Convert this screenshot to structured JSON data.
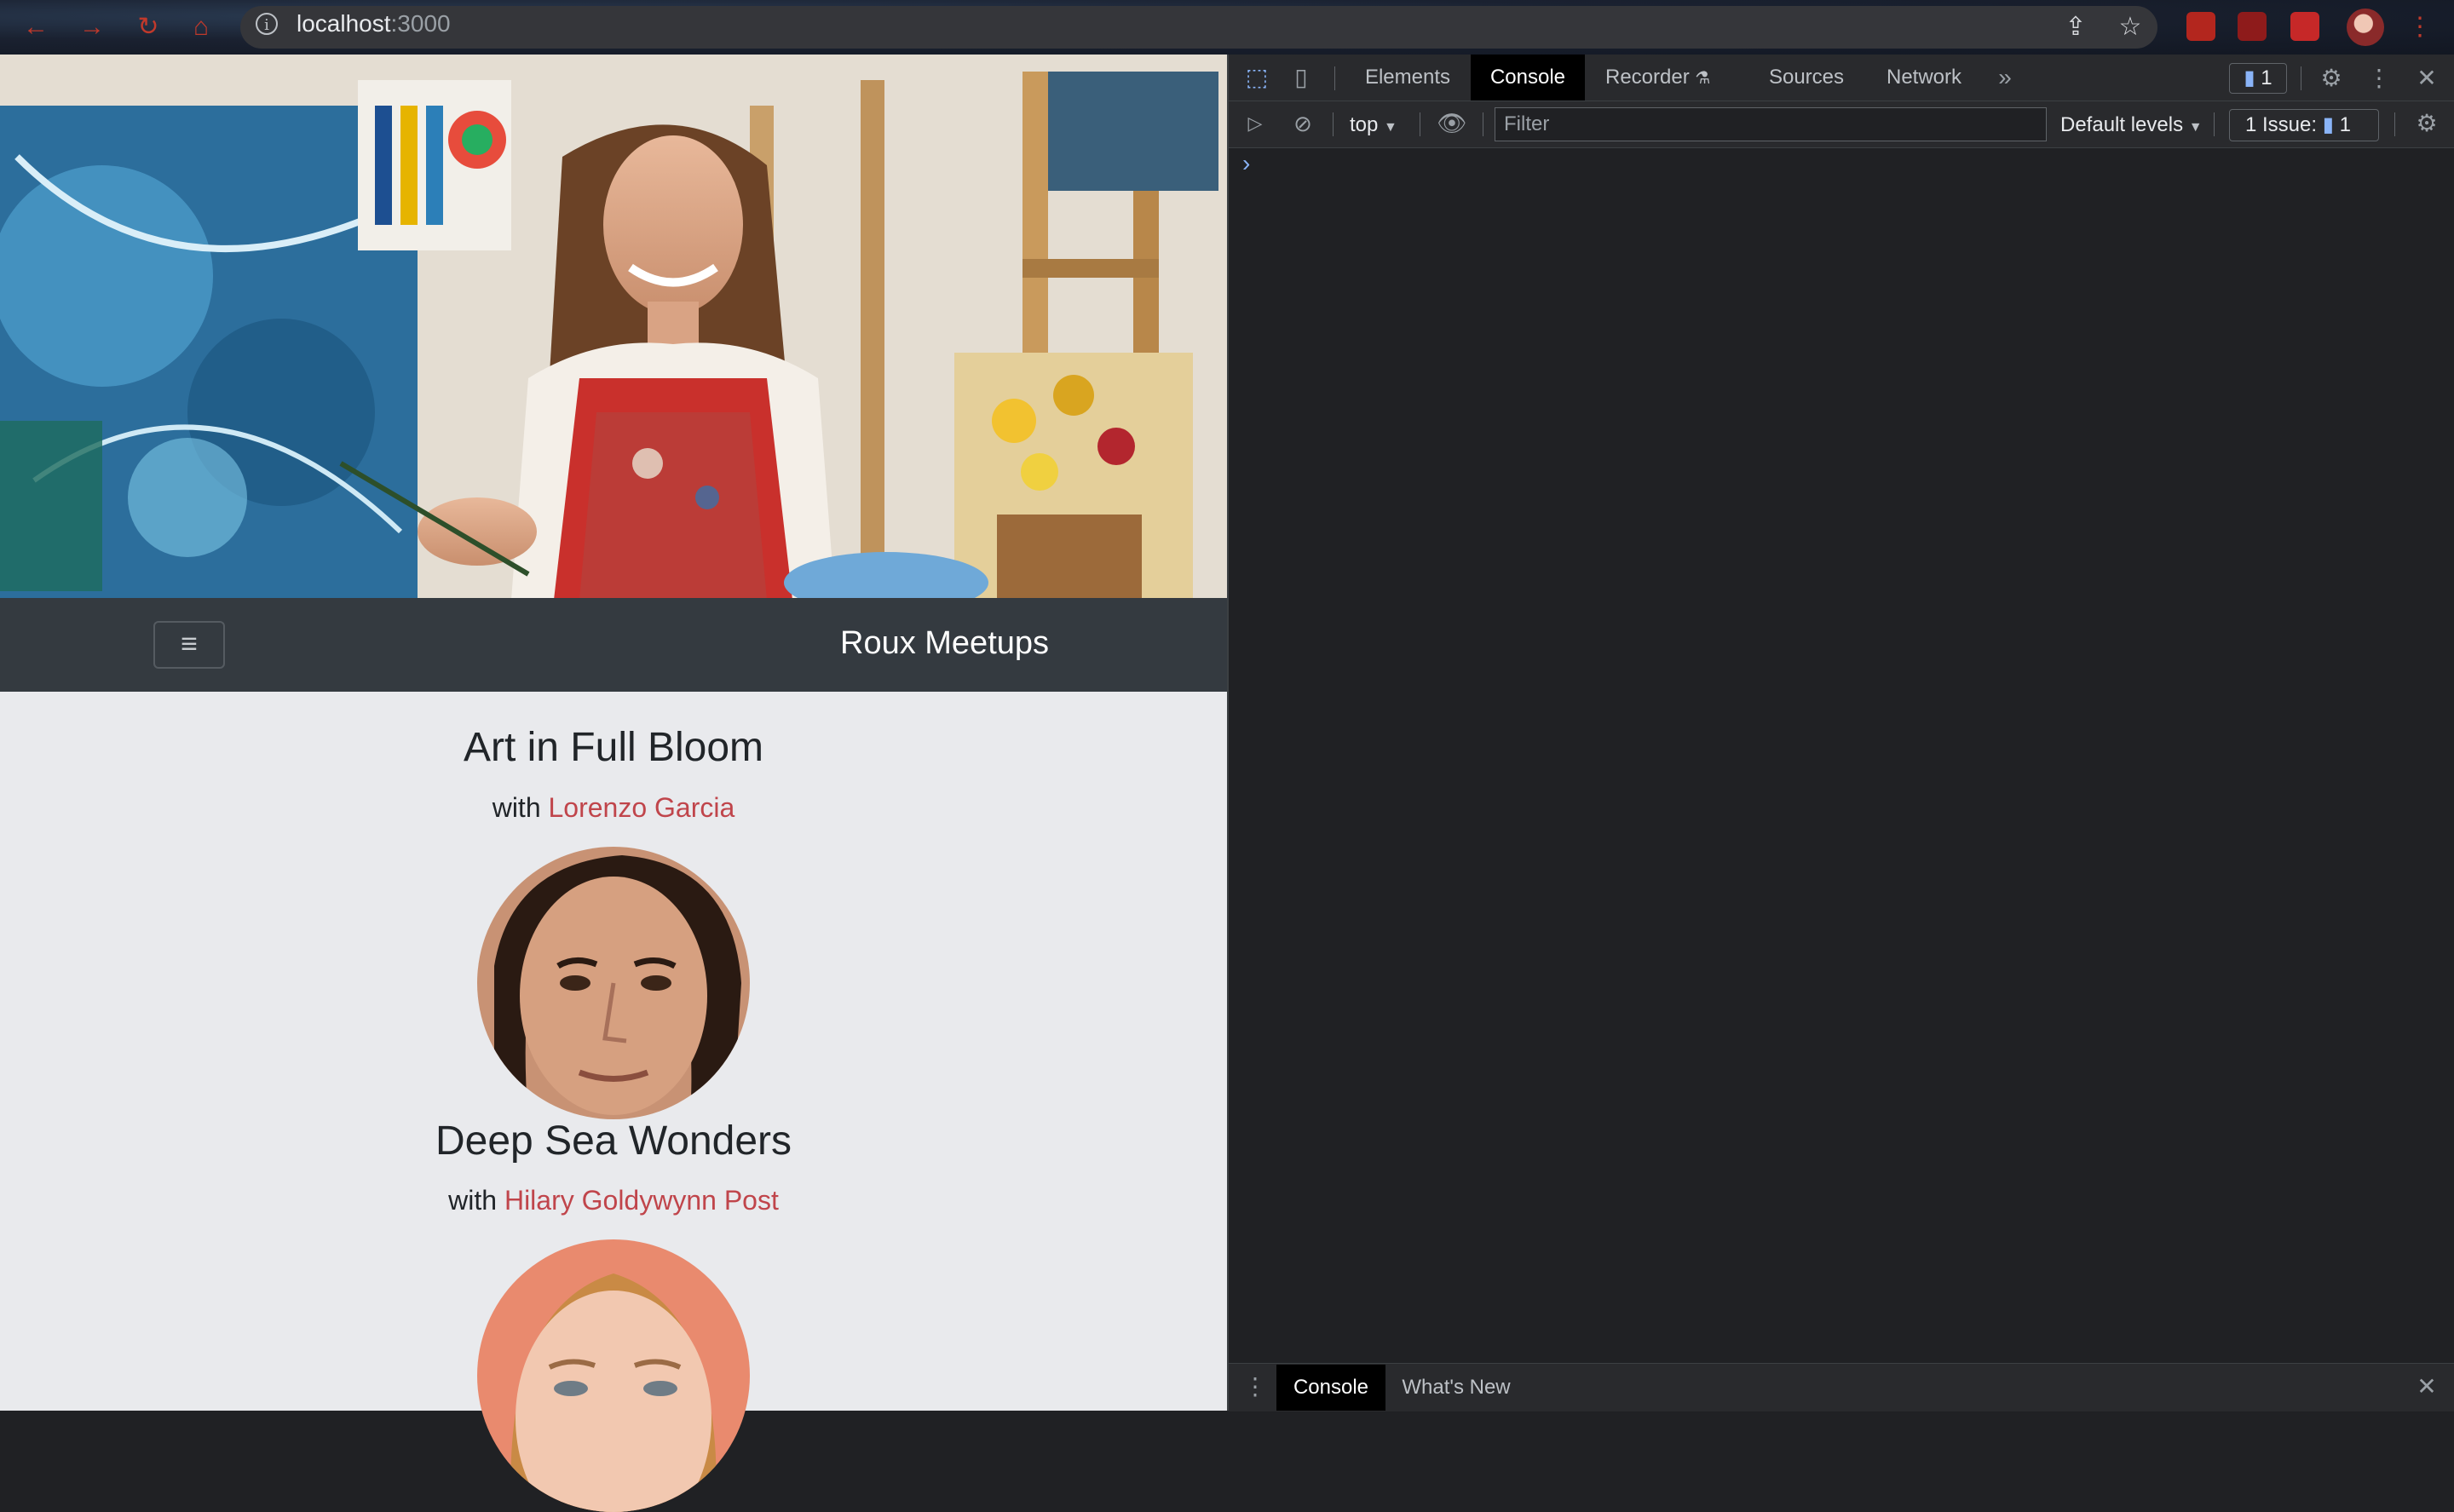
{
  "browser": {
    "url_host": "localhost",
    "url_port": ":3000"
  },
  "page": {
    "brand": "Roux Meetups",
    "menu_icon": "hamburger-icon",
    "meetups": [
      {
        "title": "Art in Full Bloom",
        "with_prefix": "with",
        "host": "Lorenzo Garcia"
      },
      {
        "title": "Deep Sea Wonders",
        "with_prefix": "with",
        "host": "Hilary Goldywynn Post"
      }
    ]
  },
  "devtools": {
    "tabs": [
      "Elements",
      "Console",
      "Recorder",
      "Sources",
      "Network"
    ],
    "active_tab": "Console",
    "issues_count": "1",
    "context": "top",
    "filter_placeholder": "Filter",
    "levels": "Default levels",
    "issues_label": "1 Issue:",
    "issues_label_count": "1",
    "prompt": "›",
    "drawer_tabs": [
      "Console",
      "What's New"
    ]
  },
  "colors": {
    "link": "#c0454b",
    "navbar": "#343a40",
    "devtools_bg": "#202124"
  }
}
